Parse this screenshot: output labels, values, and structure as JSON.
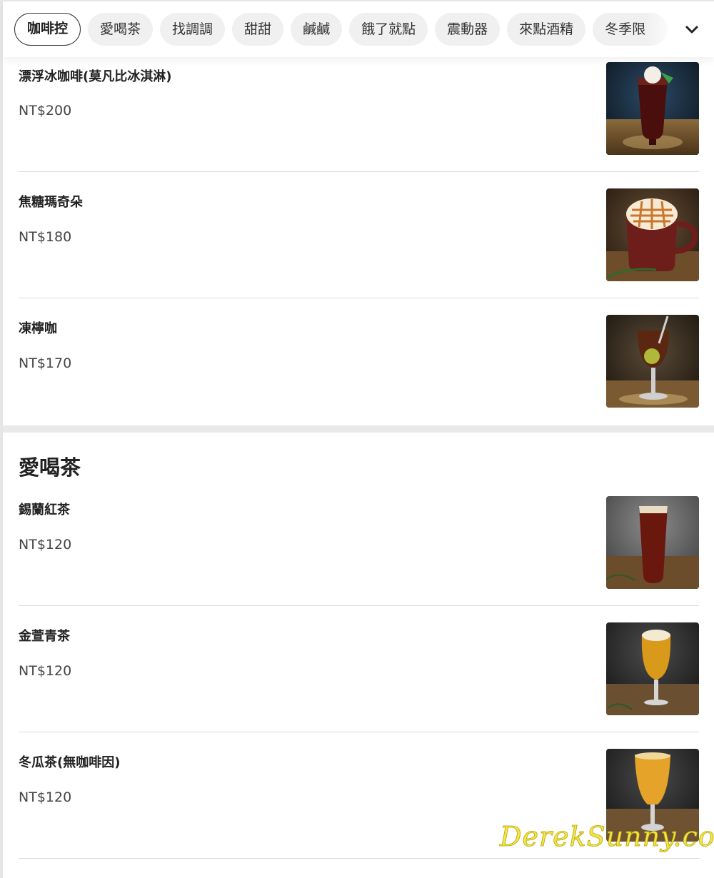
{
  "tabs": [
    {
      "label": "咖啡控",
      "active": true
    },
    {
      "label": "愛喝茶",
      "active": false
    },
    {
      "label": "找調調",
      "active": false
    },
    {
      "label": "甜甜",
      "active": false
    },
    {
      "label": "鹹鹹",
      "active": false
    },
    {
      "label": "餓了就點",
      "active": false
    },
    {
      "label": "震動器",
      "active": false
    },
    {
      "label": "來點酒精",
      "active": false
    },
    {
      "label": "冬季限",
      "active": false
    }
  ],
  "coffee_items": [
    {
      "name": "漂浮冰咖啡(莫凡比冰淇淋)",
      "price": "NT$200"
    },
    {
      "name": "焦糖瑪奇朵",
      "price": "NT$180"
    },
    {
      "name": "凍檸咖",
      "price": "NT$170"
    }
  ],
  "tea_section": {
    "title": "愛喝茶",
    "items": [
      {
        "name": "錫蘭紅茶",
        "price": "NT$120"
      },
      {
        "name": "金萱青茶",
        "price": "NT$120"
      },
      {
        "name": "冬瓜茶(無咖啡因)",
        "price": "NT$120"
      }
    ]
  },
  "watermark": "DerekSunny.com",
  "icons": {
    "expand_tabs": "chevron-down-icon"
  }
}
